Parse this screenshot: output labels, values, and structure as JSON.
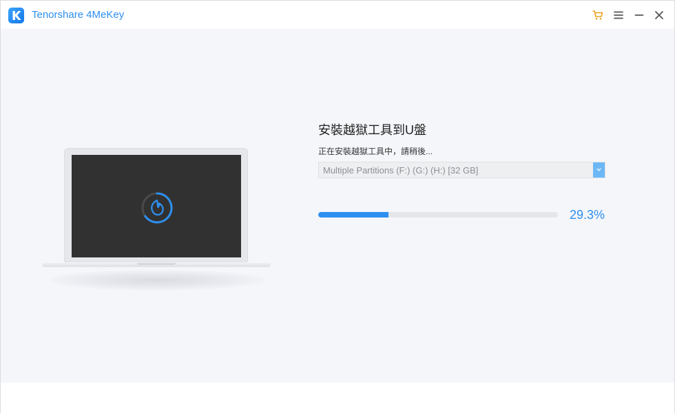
{
  "window": {
    "title": "Tenorshare 4MeKey",
    "accent_color": "#2d8ff0",
    "cart_color": "#f0a020"
  },
  "titlebar": {
    "logo_icon": "k-logo-icon",
    "buttons": [
      {
        "name": "cart",
        "icon": "cart-icon"
      },
      {
        "name": "menu",
        "icon": "menu-icon"
      },
      {
        "name": "minimize",
        "icon": "minimize-icon"
      },
      {
        "name": "close",
        "icon": "close-icon"
      }
    ]
  },
  "main": {
    "title": "安裝越獄工具到U盤",
    "subtitle": "正在安裝越獄工具中，請稍後...",
    "drive_select": {
      "value": "Multiple Partitions (F:) (G:) (H:) [32 GB]"
    },
    "progress": {
      "percent": 29.3,
      "label": "29.3%"
    }
  },
  "illustration": {
    "icon": "jailbreak-spinner-icon"
  }
}
